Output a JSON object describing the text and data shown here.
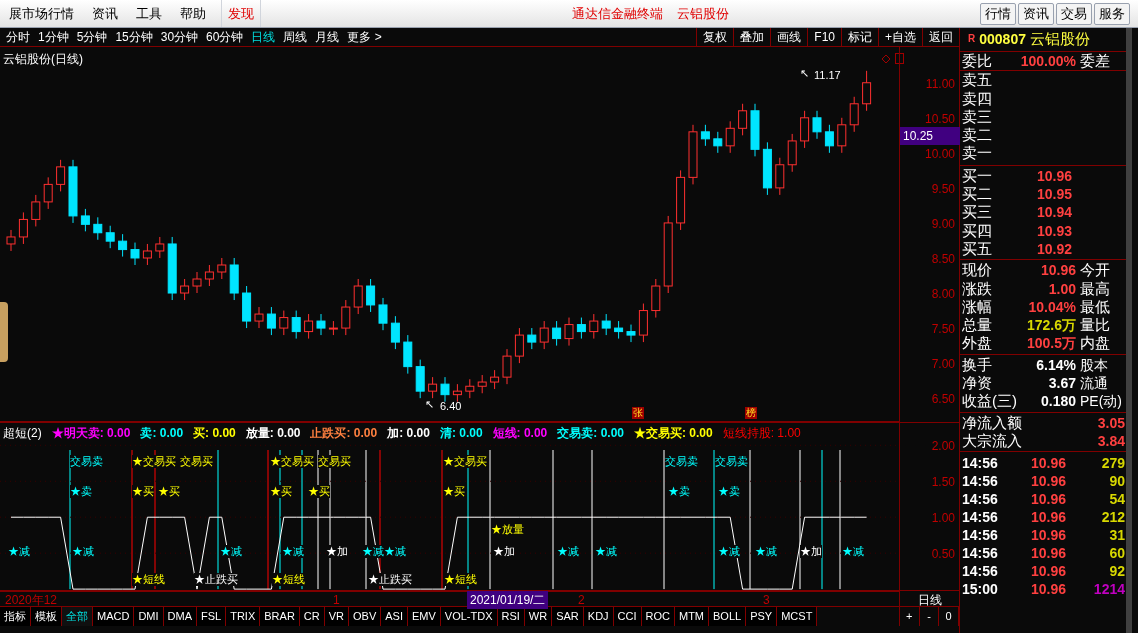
{
  "menubar": {
    "items": [
      {
        "label": "展市场行情",
        "selected": false
      },
      {
        "label": "资讯",
        "selected": false
      },
      {
        "label": "工具",
        "selected": false
      },
      {
        "label": "帮助",
        "selected": false
      }
    ],
    "discover": "发现",
    "center_titles": [
      "通达信金融终端",
      "云铝股份"
    ],
    "buttons": [
      "行情",
      "资讯",
      "交易",
      "服务"
    ]
  },
  "period_tabs": [
    {
      "label": "分时",
      "selected": false
    },
    {
      "label": "1分钟",
      "selected": false
    },
    {
      "label": "5分钟",
      "selected": false
    },
    {
      "label": "15分钟",
      "selected": false
    },
    {
      "label": "30分钟",
      "selected": false
    },
    {
      "label": "60分钟",
      "selected": false
    },
    {
      "label": "日线",
      "selected": true
    },
    {
      "label": "周线",
      "selected": false
    },
    {
      "label": "月线",
      "selected": false
    },
    {
      "label": "更多 >",
      "selected": false
    }
  ],
  "toolbar_buttons": [
    "复权",
    "叠加",
    "画线",
    "F10",
    "标记",
    "+自选",
    "返回"
  ],
  "chart": {
    "title": "云铝股份(日线)",
    "chart_data": {
      "type": "candlestick",
      "yticks": [
        {
          "value": 11,
          "label": "11.00"
        },
        {
          "value": 10.5,
          "label": "10.50"
        },
        {
          "value": 10,
          "label": "10.00"
        },
        {
          "value": 9.5,
          "label": "9.50"
        },
        {
          "value": 9,
          "label": "9.00"
        },
        {
          "value": 8.5,
          "label": "8.50"
        },
        {
          "value": 8,
          "label": "8.00"
        },
        {
          "value": 7.5,
          "label": "7.50"
        },
        {
          "value": 7,
          "label": "7.00"
        },
        {
          "value": 6.5,
          "label": "6.50"
        }
      ],
      "ylim": [
        6.16,
        11.51
      ],
      "ohlc": [
        [
          8.7,
          8.9,
          8.6,
          8.8
        ],
        [
          8.8,
          9.15,
          8.7,
          9.05
        ],
        [
          9.05,
          9.4,
          8.95,
          9.3
        ],
        [
          9.3,
          9.65,
          9.2,
          9.55
        ],
        [
          9.55,
          9.9,
          9.45,
          9.8
        ],
        [
          9.8,
          9.9,
          9.0,
          9.1
        ],
        [
          9.1,
          9.2,
          8.88,
          8.98
        ],
        [
          8.98,
          9.08,
          8.76,
          8.86
        ],
        [
          8.86,
          8.96,
          8.64,
          8.74
        ],
        [
          8.74,
          8.84,
          8.52,
          8.62
        ],
        [
          8.62,
          8.72,
          8.4,
          8.5
        ],
        [
          8.5,
          8.7,
          8.4,
          8.6
        ],
        [
          8.6,
          8.8,
          8.5,
          8.7
        ],
        [
          8.7,
          8.8,
          7.9,
          8.0
        ],
        [
          8.0,
          8.2,
          7.9,
          8.1
        ],
        [
          8.1,
          8.3,
          8.0,
          8.2
        ],
        [
          8.2,
          8.4,
          8.1,
          8.3
        ],
        [
          8.3,
          8.5,
          8.2,
          8.4
        ],
        [
          8.4,
          8.5,
          7.9,
          8.0
        ],
        [
          8.0,
          8.1,
          7.5,
          7.6
        ],
        [
          7.6,
          7.8,
          7.5,
          7.7
        ],
        [
          7.7,
          7.8,
          7.4,
          7.5
        ],
        [
          7.5,
          7.75,
          7.4,
          7.65
        ],
        [
          7.65,
          7.75,
          7.35,
          7.45
        ],
        [
          7.45,
          7.7,
          7.35,
          7.6
        ],
        [
          7.6,
          7.7,
          7.4,
          7.5
        ],
        [
          7.5,
          7.6,
          7.4,
          7.5
        ],
        [
          7.5,
          7.9,
          7.4,
          7.8
        ],
        [
          7.8,
          8.2,
          7.7,
          8.1
        ],
        [
          8.1,
          8.2,
          7.73,
          7.83
        ],
        [
          7.83,
          7.93,
          7.47,
          7.57
        ],
        [
          7.57,
          7.67,
          7.2,
          7.3
        ],
        [
          7.3,
          7.4,
          6.85,
          6.95
        ],
        [
          6.95,
          7.05,
          6.5,
          6.6
        ],
        [
          6.6,
          6.8,
          6.5,
          6.7
        ],
        [
          6.7,
          6.8,
          6.45,
          6.55
        ],
        [
          6.55,
          6.7,
          6.45,
          6.6
        ],
        [
          6.6,
          6.77,
          6.5,
          6.67
        ],
        [
          6.67,
          6.83,
          6.57,
          6.73
        ],
        [
          6.73,
          6.9,
          6.63,
          6.8
        ],
        [
          6.8,
          7.2,
          6.7,
          7.1
        ],
        [
          7.1,
          7.5,
          7.0,
          7.4
        ],
        [
          7.4,
          7.5,
          7.2,
          7.3
        ],
        [
          7.3,
          7.6,
          7.2,
          7.5
        ],
        [
          7.5,
          7.6,
          7.25,
          7.35
        ],
        [
          7.35,
          7.65,
          7.25,
          7.55
        ],
        [
          7.55,
          7.65,
          7.35,
          7.45
        ],
        [
          7.45,
          7.7,
          7.35,
          7.6
        ],
        [
          7.6,
          7.7,
          7.4,
          7.5
        ],
        [
          7.5,
          7.6,
          7.35,
          7.45
        ],
        [
          7.45,
          7.55,
          7.3,
          7.4
        ],
        [
          7.4,
          7.85,
          7.3,
          7.75
        ],
        [
          7.75,
          8.2,
          7.65,
          8.1
        ],
        [
          8.1,
          9.1,
          8.0,
          9.0
        ],
        [
          9.0,
          9.75,
          8.9,
          9.65
        ],
        [
          9.65,
          10.4,
          9.55,
          10.3
        ],
        [
          10.3,
          10.4,
          10.1,
          10.2
        ],
        [
          10.2,
          10.3,
          10.0,
          10.1
        ],
        [
          10.1,
          10.45,
          10.0,
          10.35
        ],
        [
          10.35,
          10.7,
          10.25,
          10.6
        ],
        [
          10.6,
          10.7,
          9.95,
          10.05
        ],
        [
          10.05,
          10.15,
          9.4,
          9.5
        ],
        [
          9.5,
          9.93,
          9.4,
          9.83
        ],
        [
          9.83,
          10.27,
          9.73,
          10.17
        ],
        [
          10.17,
          10.6,
          10.07,
          10.5
        ],
        [
          10.5,
          10.6,
          10.2,
          10.3
        ],
        [
          10.3,
          10.4,
          10.0,
          10.1
        ],
        [
          10.1,
          10.5,
          10.0,
          10.4
        ],
        [
          10.4,
          10.8,
          10.3,
          10.7
        ],
        [
          10.7,
          11.17,
          10.6,
          11.0
        ]
      ]
    },
    "current_price": "10.25",
    "high_label": "11.17",
    "low_label": "6.40",
    "pointer": "↖",
    "markers": [
      "张",
      "榜"
    ]
  },
  "indicator": {
    "name": "超短(2)",
    "values": [
      {
        "label": "★明天卖:",
        "value": "0.00",
        "color": "#ff00ff"
      },
      {
        "label": "卖:",
        "value": "0.00",
        "color": "#00ffff"
      },
      {
        "label": "买:",
        "value": "0.00",
        "color": "#ffff00"
      },
      {
        "label": "放量:",
        "value": "0.00",
        "color": "#ffffff"
      },
      {
        "label": "止跌买:",
        "value": "0.00",
        "color": "#ff8040"
      },
      {
        "label": "加:",
        "value": "0.00",
        "color": "#ffffff"
      },
      {
        "label": "清:",
        "value": "0.00",
        "color": "#00ffff"
      },
      {
        "label": "短线:",
        "value": "0.00",
        "color": "#ff00ff"
      },
      {
        "label": "交易卖:",
        "value": "0.00",
        "color": "#00ffff"
      },
      {
        "label": "★交易买:",
        "value": "0.00",
        "color": "#ffff00"
      }
    ],
    "legend": {
      "value": ": 1.00",
      "color": "#ff0000"
    },
    "chart_data": {
      "type": "line",
      "ylim": [
        -0.04,
        2.31
      ],
      "grid": true,
      "yticks": [
        {
          "value": 2,
          "label": "2.00"
        },
        {
          "value": 1.5,
          "label": "1.50"
        },
        {
          "value": 1,
          "label": "1.00"
        },
        {
          "value": 0.5,
          "label": "0.50"
        }
      ],
      "series": [
        {
          "name": "短线持股",
          "color": "#ffffff",
          "values": [
            1,
            1,
            1,
            1,
            1,
            0,
            0,
            0,
            0,
            0,
            0,
            1,
            1,
            1,
            1,
            0,
            1,
            1,
            0,
            0,
            0,
            0,
            1,
            1,
            1,
            1,
            1,
            1,
            1,
            1,
            0,
            0,
            0,
            0,
            0,
            0,
            1,
            1,
            1,
            1,
            1,
            1,
            1,
            1,
            1,
            1,
            1,
            1,
            1,
            1,
            1,
            1,
            1,
            1,
            1,
            1,
            1,
            1,
            1,
            0,
            0,
            0,
            0,
            0,
            1,
            1,
            1,
            1,
            1,
            1
          ]
        }
      ]
    },
    "signals": [
      {
        "text": "交易卖",
        "kind": "sell"
      },
      {
        "text": "★交易买",
        "kind": "buy"
      },
      {
        "text": "交易买",
        "kind": "buy"
      },
      {
        "text": "★交易买",
        "kind": "buy"
      },
      {
        "text": "交易买",
        "kind": "buy"
      },
      {
        "text": "★交易买",
        "kind": "buy"
      },
      {
        "text": "交易卖",
        "kind": "sell"
      },
      {
        "text": "交易卖",
        "kind": "sell"
      },
      {
        "text": "★卖",
        "kind": "sell"
      },
      {
        "text": "★买",
        "kind": "buy"
      },
      {
        "text": "★买",
        "kind": "buy"
      },
      {
        "text": "★买",
        "kind": "buy"
      },
      {
        "text": "★买",
        "kind": "buy"
      },
      {
        "text": "★买",
        "kind": "buy"
      },
      {
        "text": "★卖",
        "kind": "sell"
      },
      {
        "text": "★卖",
        "kind": "sell"
      },
      {
        "text": "★放量",
        "kind": "buy"
      },
      {
        "text": "★减",
        "kind": "sell"
      },
      {
        "text": "★减",
        "kind": "sell"
      },
      {
        "text": "★减",
        "kind": "sell"
      },
      {
        "text": "★减",
        "kind": "sell"
      },
      {
        "text": "★加",
        "kind": "add"
      },
      {
        "text": "★减",
        "kind": "sell"
      },
      {
        "text": "★减",
        "kind": "sell"
      },
      {
        "text": "★加",
        "kind": "add"
      },
      {
        "text": "★减",
        "kind": "sell"
      },
      {
        "text": "★减",
        "kind": "sell"
      },
      {
        "text": "★减",
        "kind": "sell"
      },
      {
        "text": "★减",
        "kind": "sell"
      },
      {
        "text": "★加",
        "kind": "add"
      },
      {
        "text": "★减",
        "kind": "sell"
      },
      {
        "text": "★短线",
        "kind": "buy"
      },
      {
        "text": "★止跌买",
        "kind": "add"
      },
      {
        "text": "★短线",
        "kind": "buy"
      },
      {
        "text": "★止跌买",
        "kind": "add"
      },
      {
        "text": "★短线",
        "kind": "buy"
      }
    ]
  },
  "date_axis": {
    "labels": [
      "2020年12",
      "1",
      "2",
      "3"
    ],
    "cursor": "2021/01/19/二",
    "period": "日线"
  },
  "bottom_tabs": [
    {
      "label": "指标",
      "selected": false
    },
    {
      "label": "模板",
      "selected": false
    },
    {
      "label": "全部",
      "selected": true
    },
    {
      "label": "MACD",
      "selected": false
    },
    {
      "label": "DMI",
      "selected": false
    },
    {
      "label": "DMA",
      "selected": false
    },
    {
      "label": "FSL",
      "selected": false
    },
    {
      "label": "TRIX",
      "selected": false
    },
    {
      "label": "BRAR",
      "selected": false
    },
    {
      "label": "CR",
      "selected": false
    },
    {
      "label": "VR",
      "selected": false
    },
    {
      "label": "OBV",
      "selected": false
    },
    {
      "label": "ASI",
      "selected": false
    },
    {
      "label": "EMV",
      "selected": false
    },
    {
      "label": "VOL-TDX",
      "selected": false
    },
    {
      "label": "RSI",
      "selected": false
    },
    {
      "label": "WR",
      "selected": false
    },
    {
      "label": "SAR",
      "selected": false
    },
    {
      "label": "KDJ",
      "selected": false
    },
    {
      "label": "CCI",
      "selected": false
    },
    {
      "label": "ROC",
      "selected": false
    },
    {
      "label": "MTM",
      "selected": false
    },
    {
      "label": "BOLL",
      "selected": false
    },
    {
      "label": "PSY",
      "selected": false
    },
    {
      "label": "MCST",
      "selected": false
    }
  ],
  "zoom_buttons": [
    "+",
    "-",
    "0"
  ],
  "quote": {
    "badge": "R",
    "code": "000807",
    "name": "云铝股份",
    "commission_label": "委比",
    "commission_value": "100.00%",
    "commission_diff_label": "委差",
    "asks": [
      "卖五",
      "卖四",
      "卖三",
      "卖二",
      "卖一"
    ],
    "bids": [
      {
        "label": "买一",
        "price": "10.96"
      },
      {
        "label": "买二",
        "price": "10.95"
      },
      {
        "label": "买三",
        "price": "10.94"
      },
      {
        "label": "买四",
        "price": "10.93"
      },
      {
        "label": "买五",
        "price": "10.92"
      }
    ],
    "stats": [
      {
        "label": "现价",
        "value": "10.96",
        "label2": "今开",
        "color": "#ff4040"
      },
      {
        "label": "涨跌",
        "value": "1.00",
        "label2": "最高",
        "color": "#ff4040"
      },
      {
        "label": "涨幅",
        "value": "10.04%",
        "label2": "最低",
        "color": "#ff4040"
      },
      {
        "label": "总量",
        "value": "172.6万",
        "label2": "量比",
        "color": "#d8d800"
      },
      {
        "label": "外盘",
        "value": "100.5万",
        "label2": "内盘",
        "color": "#ff4040"
      }
    ],
    "finance": [
      {
        "label": "换手",
        "value": "6.14%",
        "label2": "股本"
      },
      {
        "label": "净资",
        "value": "3.67",
        "label2": "流通"
      },
      {
        "label": "收益(三)",
        "value": "0.180",
        "label2": "PE(动)"
      }
    ],
    "flows": [
      {
        "label": "净流入额",
        "value": "3.05"
      },
      {
        "label": "大宗流入",
        "value": "3.84"
      }
    ],
    "ticks": [
      {
        "time": "14:56",
        "price": "10.96",
        "volume": "279",
        "color": "#d8d800"
      },
      {
        "time": "14:56",
        "price": "10.96",
        "volume": "90",
        "color": "#d8d800"
      },
      {
        "time": "14:56",
        "price": "10.96",
        "volume": "54",
        "color": "#d8d800"
      },
      {
        "time": "14:56",
        "price": "10.96",
        "volume": "212",
        "color": "#d8d800"
      },
      {
        "time": "14:56",
        "price": "10.96",
        "volume": "31",
        "color": "#d8d800"
      },
      {
        "time": "14:56",
        "price": "10.96",
        "volume": "60",
        "color": "#d8d800"
      },
      {
        "time": "14:56",
        "price": "10.96",
        "volume": "92",
        "color": "#d8d800"
      },
      {
        "time": "15:00",
        "price": "10.96",
        "volume": "1214",
        "color": "#c000c0"
      }
    ]
  }
}
